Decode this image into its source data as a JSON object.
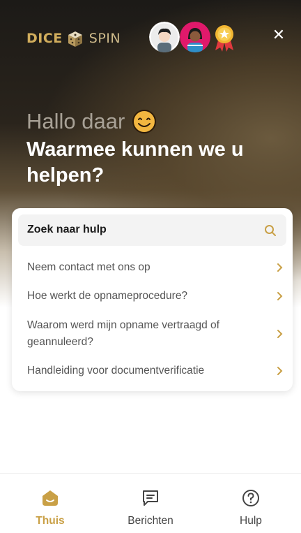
{
  "brand": {
    "part1": "DICE",
    "part2": "SPIN"
  },
  "header": {
    "greeting": "Hallo daar",
    "headline": "Waarmee kunnen we u helpen?"
  },
  "search": {
    "label": "Zoek naar hulp"
  },
  "help_items": [
    {
      "label": "Neem contact met ons op"
    },
    {
      "label": "Hoe werkt de opnameprocedure?"
    },
    {
      "label": "Waarom werd mijn opname vertraagd of geannuleerd?"
    },
    {
      "label": "Handleiding voor documentverificatie"
    }
  ],
  "nav": {
    "items": [
      {
        "label": "Thuis",
        "icon": "home-icon",
        "active": true
      },
      {
        "label": "Berichten",
        "icon": "messages-icon",
        "active": false
      },
      {
        "label": "Hulp",
        "icon": "help-icon",
        "active": false
      }
    ]
  },
  "colors": {
    "accent": "#c9a046",
    "text_muted": "#555555"
  }
}
